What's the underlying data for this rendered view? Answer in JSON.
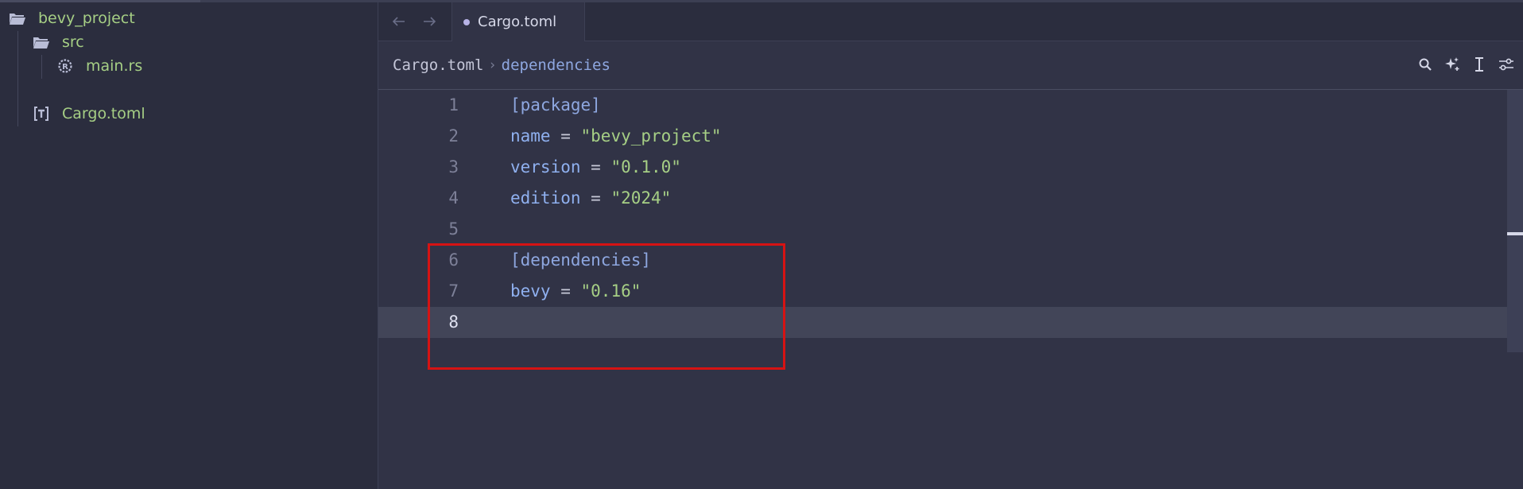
{
  "sidebar": {
    "items": [
      {
        "label": "bevy_project",
        "icon": "folder-open-icon"
      },
      {
        "label": "src",
        "icon": "folder-open-icon"
      },
      {
        "label": "main.rs",
        "icon": "rust-file-icon"
      },
      {
        "label": "Cargo.toml",
        "icon": "toml-file-icon"
      }
    ]
  },
  "tabs": [
    {
      "label": "Cargo.toml",
      "modified": true
    }
  ],
  "breadcrumb": {
    "file": "Cargo.toml",
    "separator": "›",
    "section": "dependencies"
  },
  "toolbar": {
    "icons": [
      "search-icon",
      "sparkle-icon",
      "text-cursor-icon",
      "sliders-icon"
    ]
  },
  "editor": {
    "active_line": 8,
    "lines": [
      {
        "number": "1",
        "key": "[package]",
        "op": "",
        "value": ""
      },
      {
        "number": "2",
        "key": "name",
        "op": " = ",
        "value": "\"bevy_project\""
      },
      {
        "number": "3",
        "key": "version",
        "op": " = ",
        "value": "\"0.1.0\""
      },
      {
        "number": "4",
        "key": "edition",
        "op": " = ",
        "value": "\"2024\""
      },
      {
        "number": "5",
        "key": "",
        "op": "",
        "value": ""
      },
      {
        "number": "6",
        "key": "[dependencies]",
        "op": "",
        "value": ""
      },
      {
        "number": "7",
        "key": "bevy",
        "op": " = ",
        "value": "\"0.16\""
      },
      {
        "number": "8",
        "key": "",
        "op": "",
        "value": ""
      }
    ]
  },
  "colors": {
    "accent_string": "#a6cf85",
    "accent_key": "#8fb0ef",
    "highlight_box": "#d61313"
  }
}
